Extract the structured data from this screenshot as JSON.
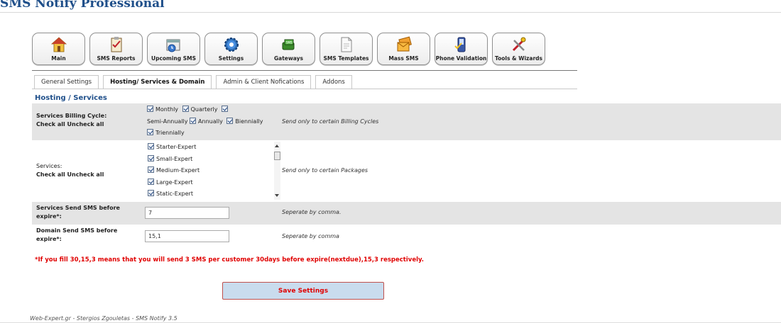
{
  "app": {
    "title": "SMS Notify Professional"
  },
  "toolbar": {
    "buttons": [
      {
        "label": "Main",
        "icon": "house-icon"
      },
      {
        "label": "SMS Reports",
        "icon": "clipboard-check-icon"
      },
      {
        "label": "Upcoming SMS",
        "icon": "calendar-clock-icon"
      },
      {
        "label": "Settings",
        "icon": "gear-icon"
      },
      {
        "label": "Gateways",
        "icon": "gateway-phone-icon"
      },
      {
        "label": "SMS Templates",
        "icon": "document-icon"
      },
      {
        "label": "Mass SMS",
        "icon": "envelopes-icon"
      },
      {
        "label": "Phone Validation",
        "icon": "phone-check-icon"
      },
      {
        "label": "Tools & Wizards",
        "icon": "tools-icon"
      }
    ]
  },
  "tabs": [
    {
      "label": "General Settings",
      "active": false
    },
    {
      "label": "Hosting/ Services & Domain",
      "active": true
    },
    {
      "label": "Admin & Client Nofications",
      "active": false
    },
    {
      "label": "Addons",
      "active": false
    }
  ],
  "section": {
    "title": "Hosting / Services"
  },
  "billing": {
    "label": "Services Billing Cycle:",
    "check_all": "Check all",
    "uncheck_all": "Uncheck all",
    "options": [
      "Monthly",
      "Quarterly",
      "Semi-Annually",
      "Annually",
      "Biennially",
      "Triennially"
    ],
    "help": "Send only to certain Billing Cycles"
  },
  "services": {
    "label": "Services:",
    "check_all": "Check all",
    "uncheck_all": "Uncheck all",
    "items": [
      "Starter-Expert",
      "Small-Expert",
      "Medium-Expert",
      "Large-Expert",
      "Static-Expert"
    ],
    "help": "Send only to certain Packages"
  },
  "services_expire": {
    "label_line1": "Services Send SMS before",
    "label_line2": "expire*:",
    "value": "7",
    "help": "Seperate by comma."
  },
  "domain_expire": {
    "label_line1": "Domain Send SMS before",
    "label_line2": "expire*:",
    "value": "15,1",
    "help": "Seperate by comma"
  },
  "note": "*If you fill 30,15,3 means that you will send 3 SMS per customer 30days before expire(nextdue),15,3 respectively.",
  "save_label": "Save Settings",
  "footer": "Web-Expert.gr - Stergios Zgouletas - SMS Notify 3.5"
}
